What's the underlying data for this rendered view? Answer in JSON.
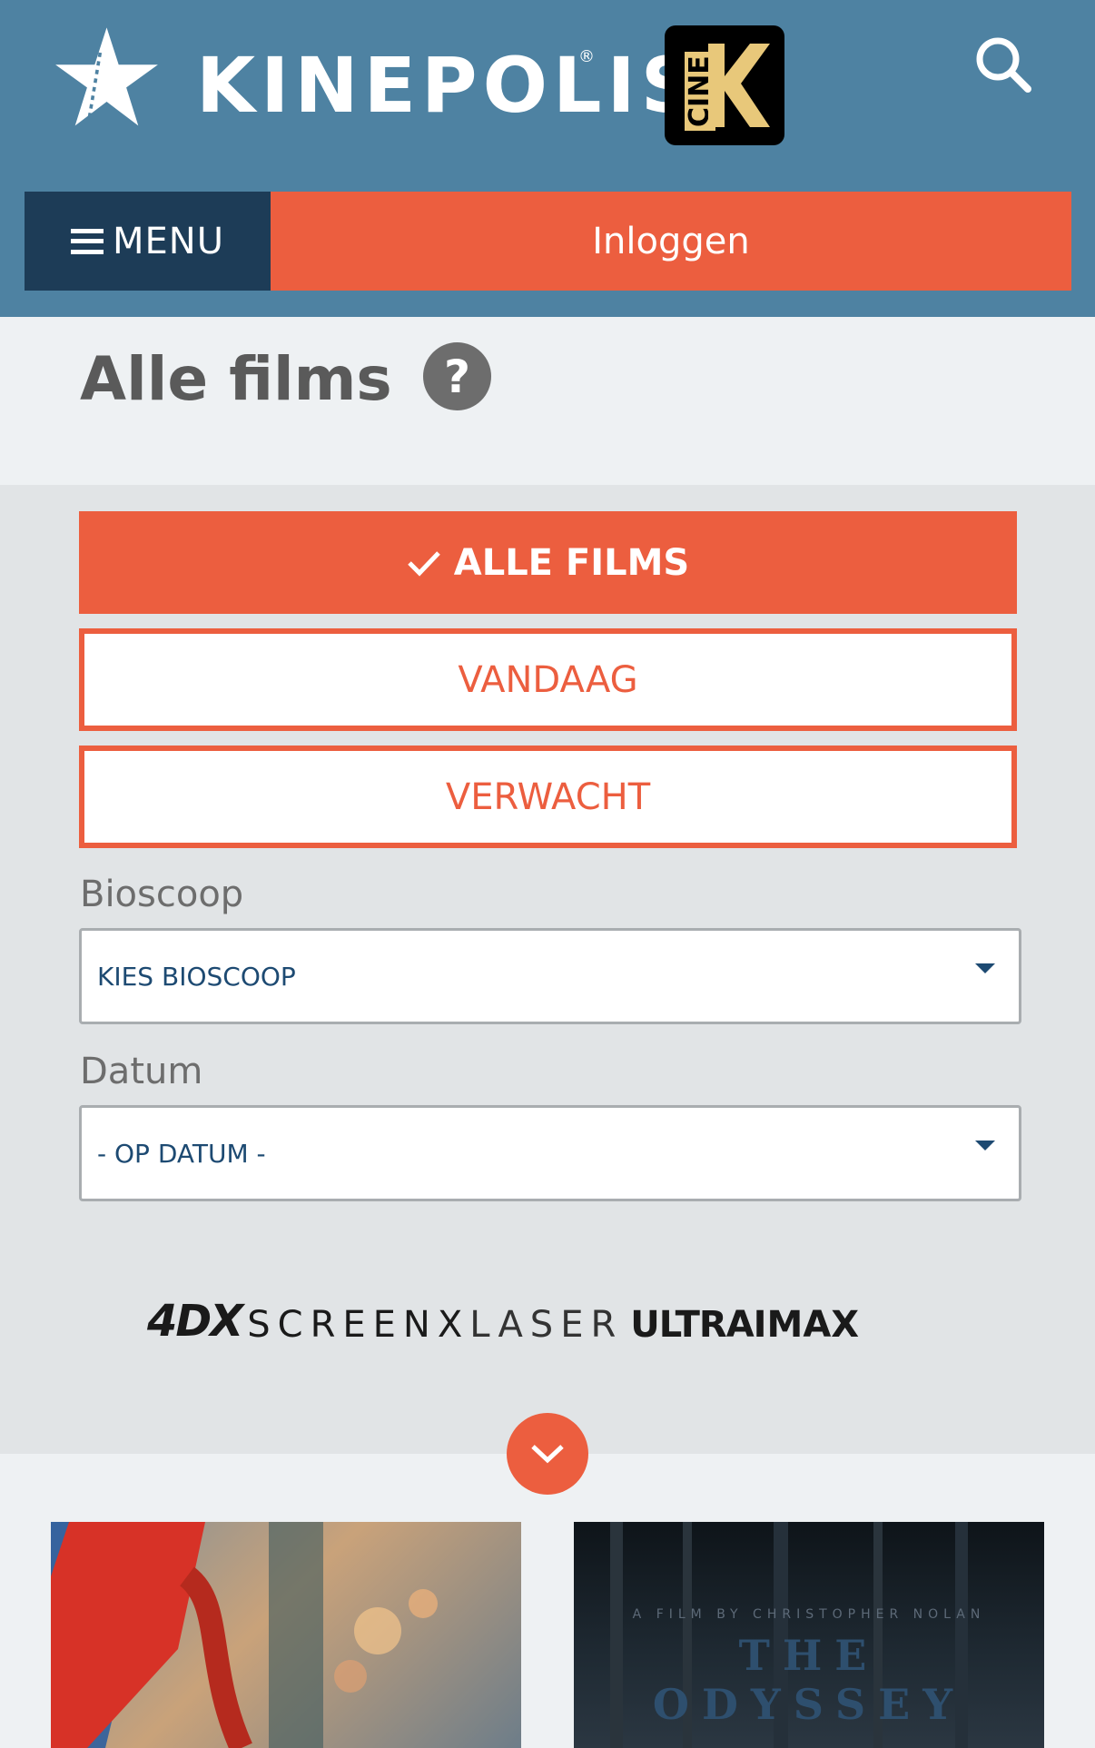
{
  "header": {
    "brand": "KINEPOLIS",
    "brand_mark": "®",
    "partner_logo": "CINE",
    "menu_label": "MENU",
    "login_label": "Inloggen",
    "colors": {
      "header_bg": "#4e82a2",
      "menu_bg": "#1d3c57",
      "accent": "#ec5e3f"
    }
  },
  "page": {
    "title": "Alle films",
    "help_glyph": "?"
  },
  "filters": {
    "tabs": [
      {
        "label": "ALLE FILMS",
        "selected": true
      },
      {
        "label": "VANDAAG",
        "selected": false
      },
      {
        "label": "VERWACHT",
        "selected": false
      }
    ],
    "bioscoop": {
      "label": "Bioscoop",
      "value": "KIES BIOSCOOP"
    },
    "datum": {
      "label": "Datum",
      "value": "- OP DATUM -"
    }
  },
  "formats": {
    "fourdx": "4DX",
    "screenx": "SCREENX",
    "laser": "LASER",
    "ultra": "ULTRA",
    "imax": "IMAX"
  },
  "posters": [
    {
      "name": "poster-spider"
    },
    {
      "credit": "A FILM BY CHRISTOPHER NOLAN",
      "title": "THE ODYSSEY"
    }
  ],
  "icons": {
    "logo": "star-logo-icon",
    "search": "search-icon",
    "menu": "hamburger-icon",
    "help": "help-icon",
    "check": "check-icon",
    "dropdown": "caret-down-icon",
    "scroll": "chevron-down-icon"
  }
}
